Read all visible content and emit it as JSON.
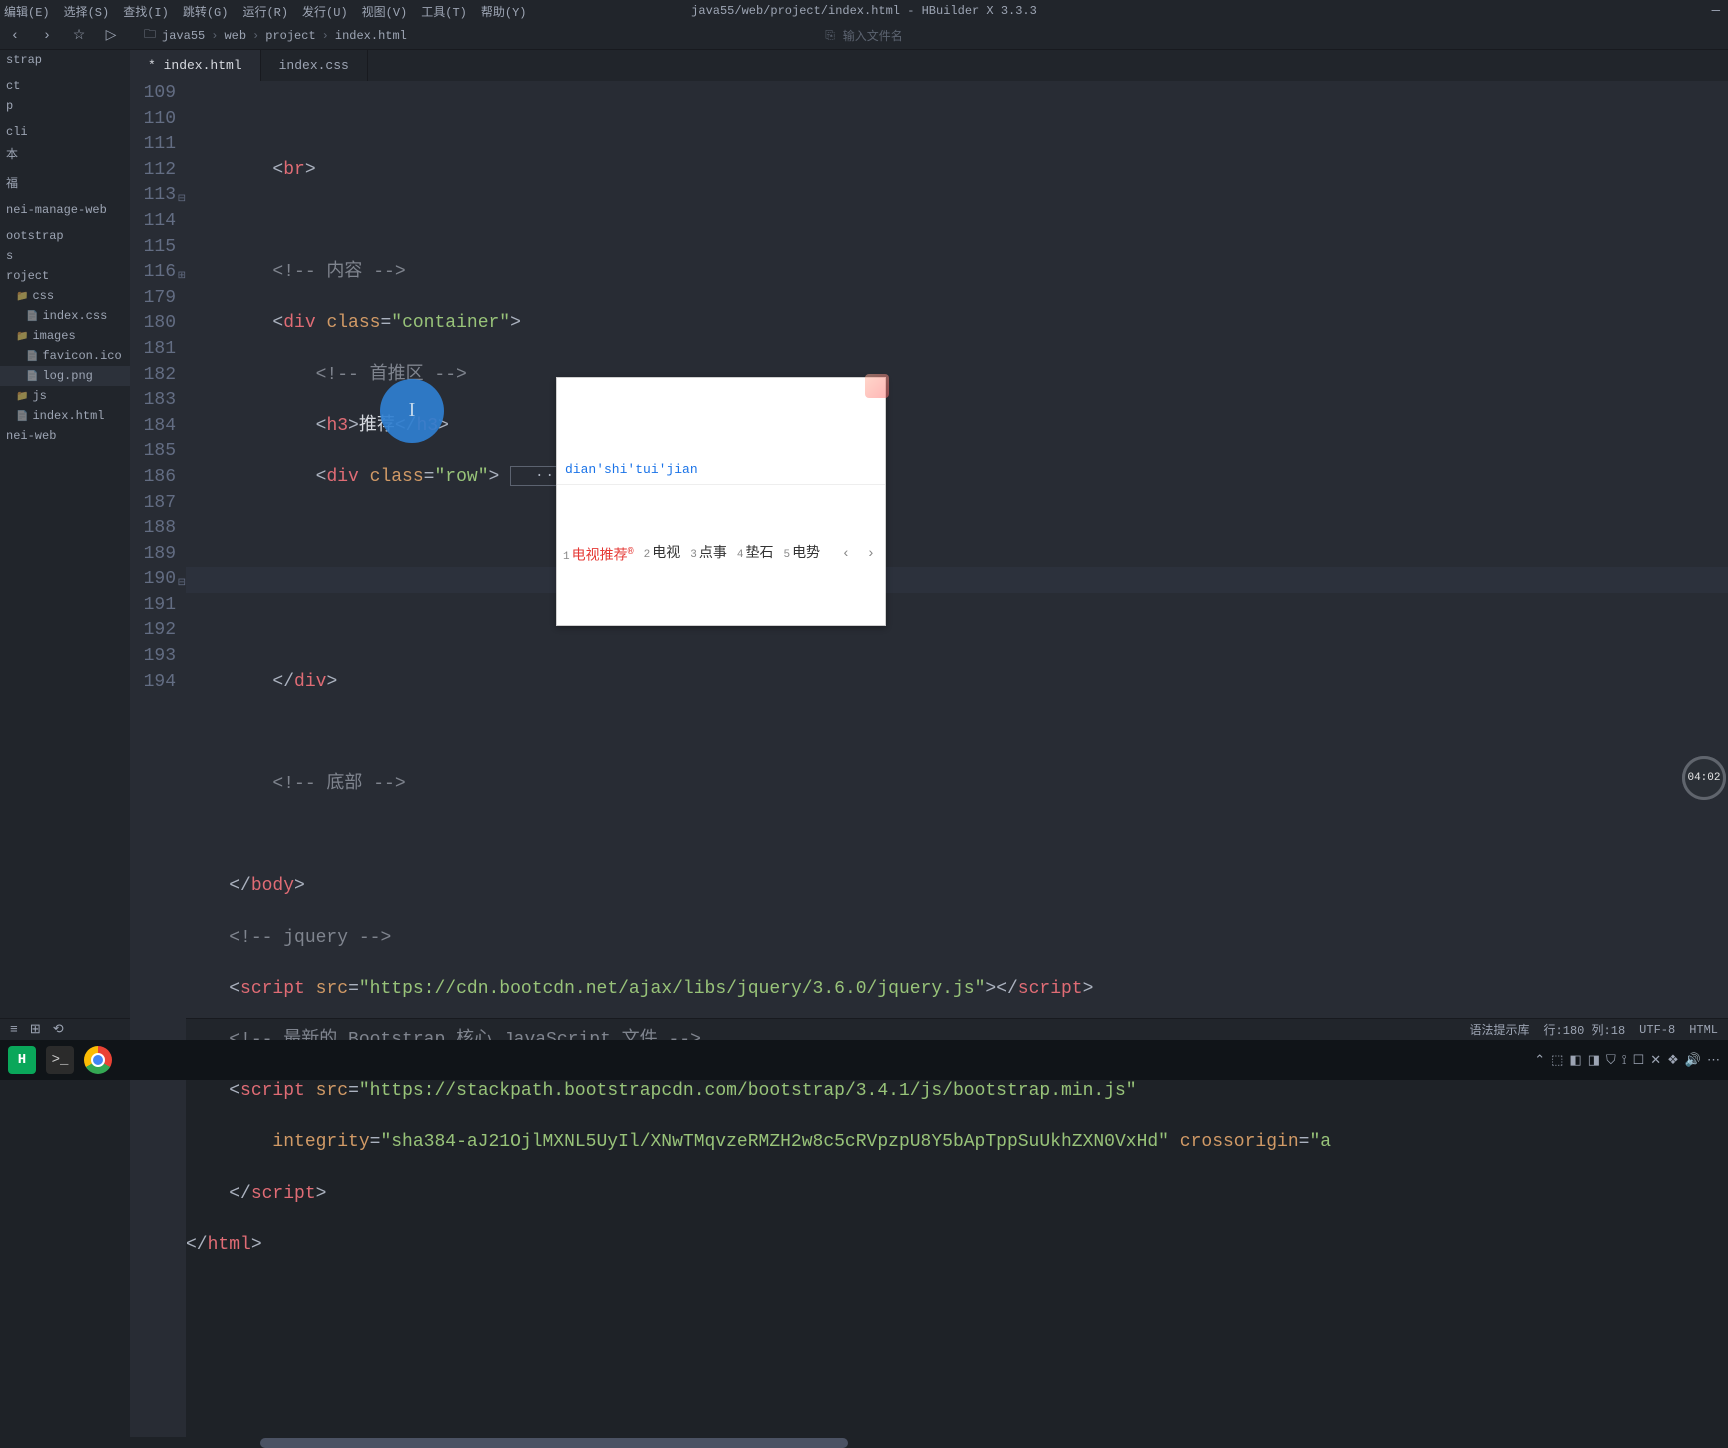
{
  "window": {
    "title": "java55/web/project/index.html - HBuilder X 3.3.3",
    "min_icon": "—"
  },
  "menu": [
    "编辑(E)",
    "选择(S)",
    "查找(I)",
    "跳转(G)",
    "运行(R)",
    "发行(U)",
    "视图(V)",
    "工具(T)",
    "帮助(Y)"
  ],
  "toolbar": {
    "back": "‹",
    "forward": "›",
    "star": "☆",
    "play": "▷",
    "folder": "🗀",
    "search_icon": "⎘",
    "search_placeholder": "输入文件名"
  },
  "breadcrumb": [
    "java55",
    "web",
    "project",
    "index.html"
  ],
  "sidebar": [
    {
      "label": "strap",
      "cls": ""
    },
    {
      "label": "",
      "cls": ""
    },
    {
      "label": "ct",
      "cls": ""
    },
    {
      "label": "p",
      "cls": ""
    },
    {
      "label": "",
      "cls": ""
    },
    {
      "label": "cli",
      "cls": ""
    },
    {
      "label": "本",
      "cls": ""
    },
    {
      "label": "",
      "cls": ""
    },
    {
      "label": "福",
      "cls": ""
    },
    {
      "label": "",
      "cls": ""
    },
    {
      "label": "nei-manage-web",
      "cls": ""
    },
    {
      "label": "",
      "cls": ""
    },
    {
      "label": "ootstrap",
      "cls": ""
    },
    {
      "label": "s",
      "cls": ""
    },
    {
      "label": "roject",
      "cls": ""
    },
    {
      "label": "css",
      "cls": "indent1 icon-folder"
    },
    {
      "label": "index.css",
      "cls": "indent2 icon-file"
    },
    {
      "label": "images",
      "cls": "indent1 icon-folder"
    },
    {
      "label": "favicon.ico",
      "cls": "indent2 icon-file"
    },
    {
      "label": "log.png",
      "cls": "indent2 icon-file sel"
    },
    {
      "label": "js",
      "cls": "indent1 icon-folder"
    },
    {
      "label": "index.html",
      "cls": "indent1 icon-file"
    },
    {
      "label": "nei-web",
      "cls": ""
    }
  ],
  "tabs": [
    {
      "label": "* index.html",
      "active": true
    },
    {
      "label": "index.css",
      "active": false
    }
  ],
  "lines": [
    {
      "n": "109",
      "fold": ""
    },
    {
      "n": "110",
      "fold": ""
    },
    {
      "n": "111",
      "fold": ""
    },
    {
      "n": "112",
      "fold": ""
    },
    {
      "n": "113",
      "fold": "⊟"
    },
    {
      "n": "114",
      "fold": ""
    },
    {
      "n": "115",
      "fold": ""
    },
    {
      "n": "116",
      "fold": "⊞"
    },
    {
      "n": "179",
      "fold": ""
    },
    {
      "n": "180",
      "fold": ""
    },
    {
      "n": "181",
      "fold": ""
    },
    {
      "n": "182",
      "fold": ""
    },
    {
      "n": "183",
      "fold": ""
    },
    {
      "n": "184",
      "fold": ""
    },
    {
      "n": "185",
      "fold": ""
    },
    {
      "n": "186",
      "fold": ""
    },
    {
      "n": "187",
      "fold": ""
    },
    {
      "n": "188",
      "fold": ""
    },
    {
      "n": "189",
      "fold": ""
    },
    {
      "n": "190",
      "fold": "⊟"
    },
    {
      "n": "191",
      "fold": ""
    },
    {
      "n": "192",
      "fold": ""
    },
    {
      "n": "193",
      "fold": ""
    },
    {
      "n": "194",
      "fold": ""
    }
  ],
  "code": {
    "l110_br": "br",
    "comment_content": "<!-- 内容 -->",
    "l113_div": "div",
    "l113_class": "class",
    "l113_val": "\"container\"",
    "comment_shoutui": "<!-- 首推区 -->",
    "l115_h3": "h3",
    "l115_text": "推荐",
    "l116_div": "div",
    "l116_class": "class",
    "l116_val": "\"row\"",
    "l116_fold": "···",
    "l182_div": "div",
    "comment_bottom": "<!-- 底部 -->",
    "l186_body": "body",
    "comment_jquery": "<!-- jquery -->",
    "l188_script": "script",
    "l188_src": "src",
    "l188_url": "\"https://cdn.bootcdn.net/ajax/libs/jquery/3.6.0/jquery.js\"",
    "comment_bs": "<!-- 最新的 Bootstrap 核心 JavaScript 文件 -->",
    "l190_script": "script",
    "l190_src": "src",
    "l190_url": "\"https://stackpath.bootstrapcdn.com/bootstrap/3.4.1/js/bootstrap.min.js\"",
    "l191_integrity": "integrity",
    "l191_ival": "\"sha384-aJ21OjlMXNL5UyIl/XNwTMqvzeRMZH2w8c5cRVpzpU8Y5bApTppSuUkhZXN0VxHd\"",
    "l191_co": "crossorigin",
    "l191_coval": "\"a",
    "l192_script": "script",
    "l193_html": "html"
  },
  "ime": {
    "input": "dian'shi'tui'jian",
    "candidates": [
      {
        "n": "1",
        "t": "电视推荐",
        "sel": true,
        "sup": "®"
      },
      {
        "n": "2",
        "t": "电视"
      },
      {
        "n": "3",
        "t": "点事"
      },
      {
        "n": "4",
        "t": "垫石"
      },
      {
        "n": "5",
        "t": "电势"
      }
    ],
    "pager": "‹ ›"
  },
  "status": {
    "icons": [
      "≡",
      "⊞",
      "⟲"
    ],
    "syntax": "语法提示库",
    "pos": "行:180  列:18",
    "enc": "UTF-8",
    "lang": "HTML"
  },
  "timer": "04:02",
  "tray": [
    "⌃",
    "⬚",
    "◧",
    "◨",
    "⛉",
    "⟟",
    "☐",
    "✕",
    "❖",
    "🔊",
    "⋯"
  ]
}
